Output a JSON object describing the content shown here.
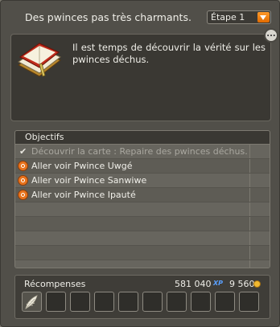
{
  "quest": {
    "title": "Des pwinces pas très charmants.",
    "stage_label": "Étape 1",
    "more_button": "...",
    "description": "Il est temps de découvrir la vérité sur les pwinces déchus."
  },
  "objectives": {
    "header": "Objectifs",
    "items": [
      {
        "text": "Découvrir la carte : Repaire des pwinces déchus.",
        "done": true
      },
      {
        "text": "Aller voir Pwince Uwgé",
        "done": false
      },
      {
        "text": "Aller voir Pwince Sanwiwe",
        "done": false
      },
      {
        "text": "Aller voir Pwince Ipauté",
        "done": false
      }
    ]
  },
  "rewards": {
    "label": "Récompenses",
    "xp": "581 040",
    "xp_tag": "XP",
    "kamas": "9 560",
    "slot_count": 10,
    "filled_slots": [
      "feather-icon"
    ]
  },
  "colors": {
    "accent": "#e8731d",
    "panel": "#3a3833",
    "window": "#514f49"
  }
}
